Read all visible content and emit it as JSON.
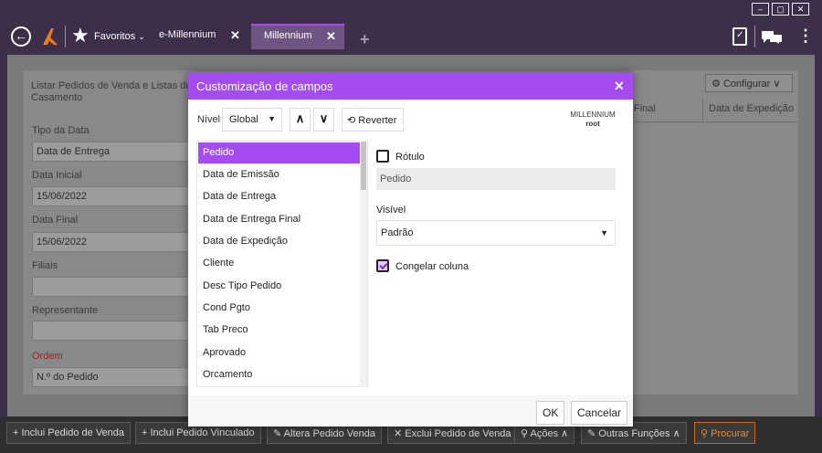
{
  "header": {
    "window_controls": [
      "–",
      "▢",
      "✕"
    ],
    "favorites_label": "Favoritos",
    "favorites_chevron": "⌄",
    "tabs": [
      {
        "label": "e-Millennium",
        "close": "✕"
      },
      {
        "label": "Millennium",
        "close": "✕"
      }
    ],
    "add_tab": "+",
    "back_icon": "←",
    "more_icon": "⋮"
  },
  "background": {
    "title": "Listar Pedidos de Venda e Listas de Casamento",
    "fields": [
      {
        "label": "Tipo da Data",
        "value": "Data de Entrega"
      },
      {
        "label": "Data Inicial",
        "value": "15/06/2022"
      },
      {
        "label": "Data Final",
        "value": "15/06/2022"
      },
      {
        "label": "Filiais",
        "value": ""
      },
      {
        "label": "Representante",
        "value": ""
      },
      {
        "label": "Ordem",
        "value": "N.º do Pedido"
      }
    ],
    "configure_label": "Configurar",
    "columns": [
      "Final",
      "Data de Expedição"
    ]
  },
  "toolbar": {
    "buttons": [
      "+ Inclui Pedido de Venda",
      "+ Inclui Pedido Vinculado",
      "Altera Pedido Venda",
      "Exclui Pedido de Venda",
      "Ações",
      "Outras Funções",
      "Procurar"
    ]
  },
  "dialog": {
    "title": "Customização de campos",
    "close": "✕",
    "nivel_label": "Nível",
    "nivel_value": "Global",
    "up": "∧",
    "down": "∨",
    "revert_label": "Reverter",
    "user_line1": "MILLENNIUM",
    "user_line2": "root",
    "fields": [
      "Pedido",
      "Data de Emissão",
      "Data de Entrega",
      "Data de Entrega Final",
      "Data de Expedição",
      "Cliente",
      "Desc Tipo Pedido",
      "Cond Pgto",
      "Tab Preco",
      "Aprovado",
      "Orcamento"
    ],
    "rotulo_label": "Rótulo",
    "rotulo_checked": false,
    "rotulo_value": "Pedido",
    "visivel_label": "Visível",
    "visivel_value": "Padrão",
    "congelar_label": "Congelar coluna",
    "congelar_checked": true,
    "ok_label": "OK",
    "cancel_label": "Cancelar"
  },
  "colors": {
    "accent": "#a54cf0",
    "topbar": "#3d2f4a",
    "search_orange": "#e88a35",
    "logo_orange": "#f07b1a"
  }
}
